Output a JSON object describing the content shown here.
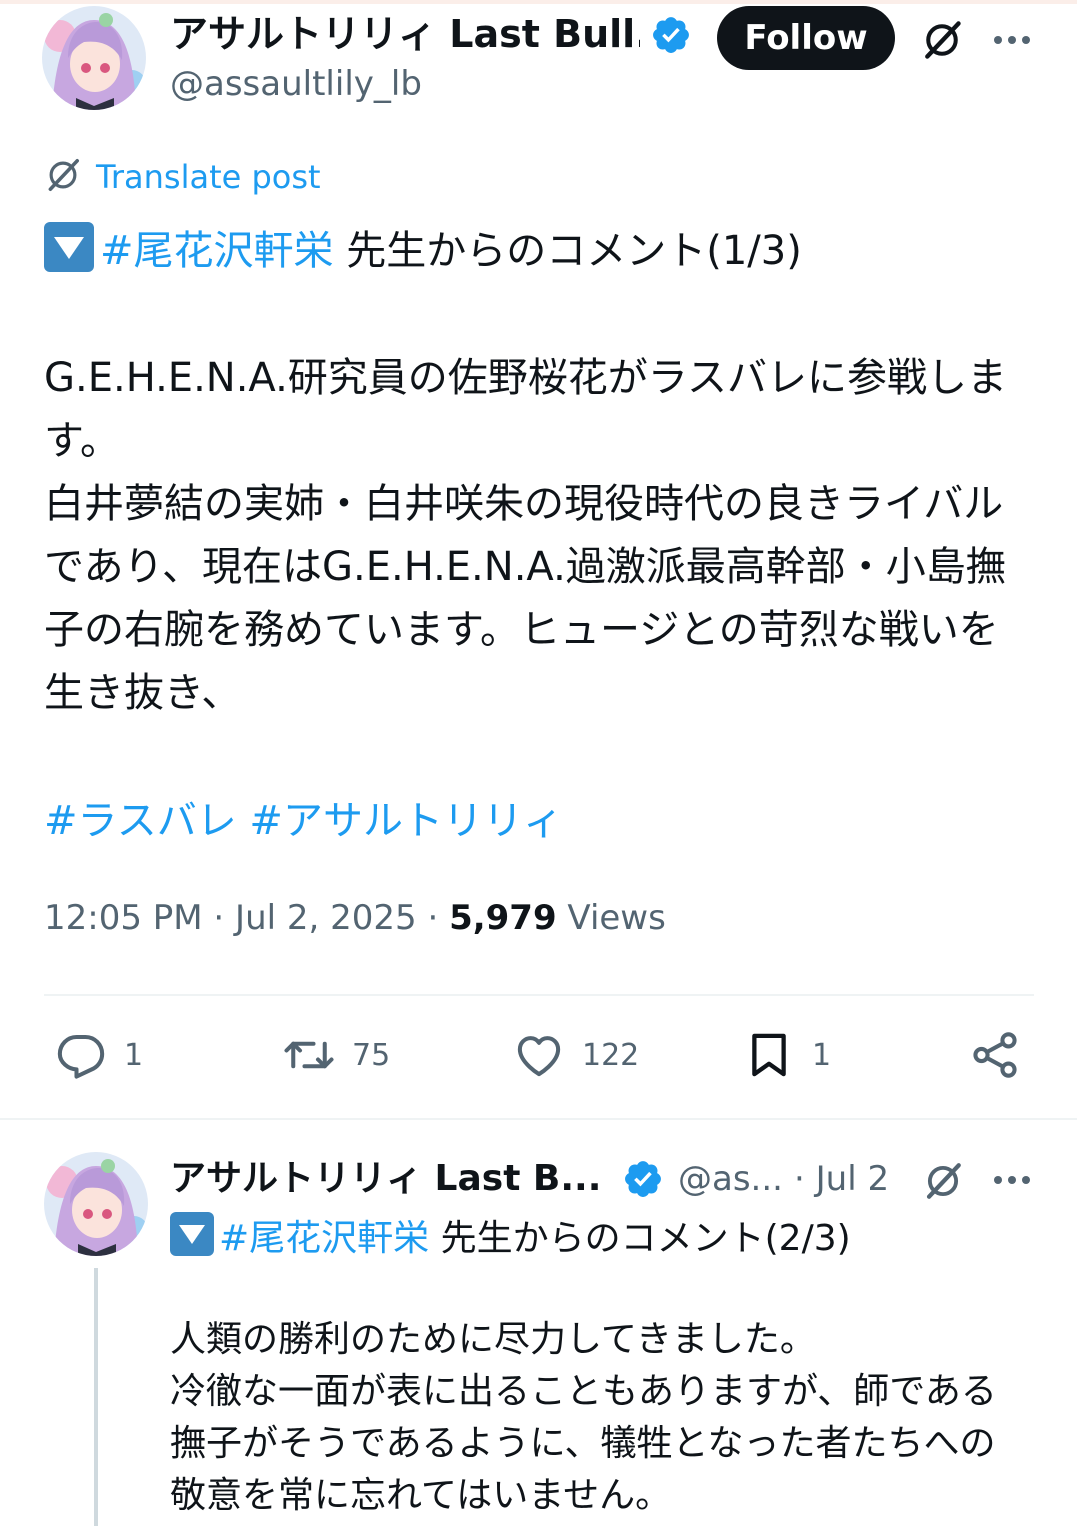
{
  "main_post": {
    "author_name": "アサルトリリィ Last Bull...",
    "author_handle": "@assaultlily_lb",
    "follow_label": "Follow",
    "translate_label": "Translate post",
    "hashtag_line_tag": "#尾花沢軒栄",
    "hashtag_line_rest": " 先生からのコメント(1/3)",
    "body": "G.E.H.E.N.A.研究員の佐野桜花がラスバレに参戦します。\n白井夢結の実姉・白井咲朱の現役時代の良きライバルであり、現在はG.E.H.E.N.A.過激派最高幹部・小島撫子の右腕を務めています。ヒュージとの苛烈な戦いを生き抜き、",
    "tags": "#ラスバレ #アサルトリリィ",
    "time": "12:05 PM · Jul 2, 2025 · ",
    "views_count": "5,979",
    "views_label": " Views",
    "actions": {
      "replies": "1",
      "reposts": "75",
      "likes": "122",
      "bookmarks": "1"
    }
  },
  "reply_post": {
    "author_name": "アサルトリリィ Last B...",
    "author_handle": "@as...",
    "date": "· Jul 2",
    "hashtag_line_tag": "#尾花沢軒栄",
    "hashtag_line_rest": " 先生からのコメント(2/3)",
    "body": "人類の勝利のために尽力してきました。\n冷徹な一面が表に出ることもありますが、師である撫子がそうであるように、犠牲となった者たちへの敬意を常に忘れてはいません。"
  },
  "colors": {
    "accent": "#1d9bf0",
    "text": "#0f1419",
    "muted": "#536471",
    "verified": "#1d9bf0",
    "emoji_box": "#3b88c3"
  },
  "icons": [
    "verified-badge-icon",
    "grok-icon",
    "more-icon",
    "translate-icon",
    "reply-icon",
    "repost-icon",
    "like-icon",
    "bookmark-icon",
    "share-icon",
    "down-triangle-emoji"
  ]
}
